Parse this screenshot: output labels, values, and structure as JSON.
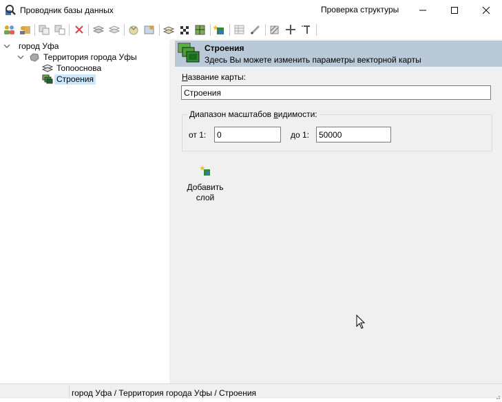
{
  "window": {
    "title": "Проводник базы данных",
    "icon": "magnifier-database-icon",
    "controls": [
      "minimize-icon",
      "maximize-icon",
      "close-icon"
    ]
  },
  "toolbar": {
    "icons": [
      "users-icon",
      "user-db-icon",
      "copy-icon",
      "paste-icon",
      "delete-icon",
      "layers-icon",
      "layers-alt-icon",
      "globe-icon",
      "map-icon",
      "stack-icon",
      "checker-icon",
      "grid-map-icon",
      "add-layer-icon",
      "table-icon",
      "pencil-icon",
      "hatch-icon",
      "pin-icon",
      "text-tool-icon"
    ],
    "check_structure_label": "Проверка структуры"
  },
  "tree": {
    "root": "город Уфа",
    "child": "Территория города Уфы",
    "items": [
      "Топооснова",
      "Строения"
    ],
    "selected": "Строения"
  },
  "panel": {
    "header_title": "Строения",
    "header_desc": "Здесь Вы можете изменить параметры векторной карты",
    "map_name_label_accel": "Н",
    "map_name_label_rest": "азвание карты:",
    "map_name_value": "Строения",
    "range_legend_pre": "Диапазон масштабов ",
    "range_legend_accel": "в",
    "range_legend_post": "идимости:",
    "from_label": "от 1:",
    "from_value": "0",
    "to_label": "до 1:",
    "to_value": "50000",
    "add_layer_line1": "Добавить",
    "add_layer_line2": "слой"
  },
  "status": {
    "path": "город Уфа / Территория города Уфы / Строения"
  },
  "colors": {
    "header_bg": "#b9c9d8",
    "selection_bg": "#cce8ff",
    "panel_bg": "#f0f0f0"
  }
}
